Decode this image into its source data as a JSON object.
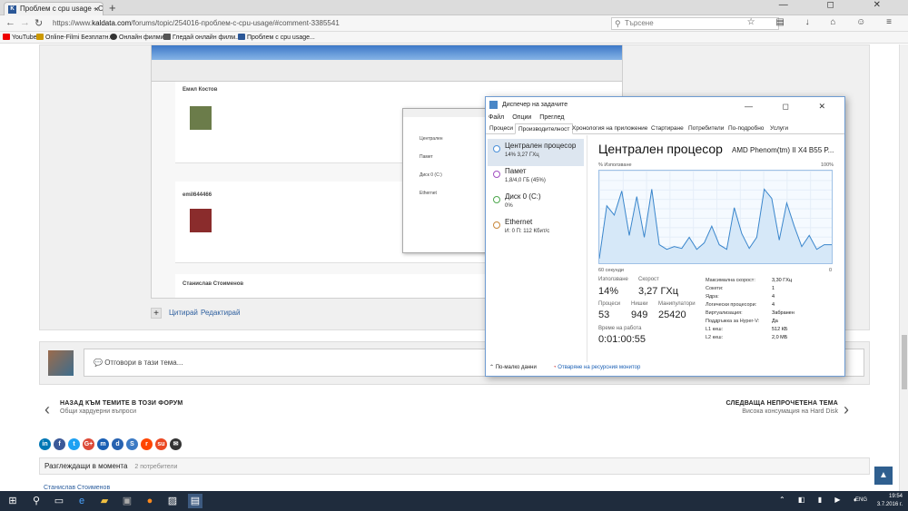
{
  "browser": {
    "tab_title": "Проблем с cpu usage - O...",
    "url_prefix": "https://www.",
    "url_domain": "kaldata.com",
    "url_rest": "/forums/topic/254016-проблем-с-cpu-usage/#comment-3385541",
    "search_placeholder": "Търсене",
    "bookmarks": [
      "YouTube",
      "Online-Filmi Безплатн...",
      "Онлайн филми",
      "Гледай онлайн филм...",
      "Проблем с cpu usage..."
    ]
  },
  "post_actions": {
    "quote": "Цитирай",
    "edit": "Редактирай"
  },
  "reply": {
    "placeholder": "Отговори в тази тема..."
  },
  "prev": {
    "title": "НАЗАД КЪМ ТЕМИТЕ В ТОЗИ ФОРУМ",
    "subtitle": "Общи хардуерни въпроси"
  },
  "next": {
    "title": "СЛЕДВАЩА НЕПРОЧЕТЕНА ТЕМА",
    "subtitle": "Висока консумация на Hard Disk"
  },
  "share_buttons": [
    "in",
    "f",
    "t",
    "G+",
    "m",
    "d",
    "S",
    "r",
    "su",
    "✉"
  ],
  "viewing": {
    "label": "Разглеждащи в момента",
    "count": "2 потребители"
  },
  "last_viewer": "Станислав Стоименов",
  "taskmanager": {
    "title": "Диспечер на задачите",
    "menu": [
      "Файл",
      "Опции",
      "Преглед"
    ],
    "tabs": [
      "Процеси",
      "Производителност",
      "Хронология на приложение",
      "Стартиране",
      "Потребители",
      "По-подробно",
      "Услуги"
    ],
    "resources": [
      {
        "name": "Централен процесор",
        "value": "14%  3,27 ГХц"
      },
      {
        "name": "Памет",
        "value": "1,8/4,0 ГБ (45%)"
      },
      {
        "name": "Диск 0 (C:)",
        "value": "0%"
      },
      {
        "name": "Ethernet",
        "value": "И: 0  П: 112 Кбит/с"
      }
    ],
    "cpu_heading": "Централен процесор",
    "cpu_model": "AMD Phenom(tm) II X4 B55 P...",
    "usage_label": "% Използване",
    "max_label": "100%",
    "time_label": "60 секунди",
    "zero_label": "0",
    "stats": {
      "usage_label": "Използване",
      "usage": "14%",
      "speed_label": "Скорост",
      "speed": "3,27 ГХц",
      "processes_label": "Процеси",
      "processes": "53",
      "threads_label": "Нишки",
      "threads": "949",
      "handles_label": "Манипулатори",
      "handles": "25420",
      "uptime_label": "Време на работа",
      "uptime": "0:01:00:55"
    },
    "specs": [
      {
        "k": "Максимална скорост:",
        "v": "3,30 ГХц"
      },
      {
        "k": "Сокети:",
        "v": "1"
      },
      {
        "k": "Ядра:",
        "v": "4"
      },
      {
        "k": "Логически процесори:",
        "v": "4"
      },
      {
        "k": "Виртуализация:",
        "v": "Забранен"
      },
      {
        "k": "Поддръжка за Hyper-V:",
        "v": "Да"
      },
      {
        "k": "L1 кеш:",
        "v": "512 КБ"
      },
      {
        "k": "L2 кеш:",
        "v": "2,0 МБ"
      }
    ],
    "cpu_history": [
      5,
      62,
      52,
      78,
      30,
      72,
      28,
      80,
      20,
      15,
      18,
      16,
      28,
      15,
      22,
      40,
      20,
      15,
      60,
      32,
      16,
      28,
      80,
      70,
      25,
      65,
      40,
      18,
      30,
      15,
      20,
      20
    ],
    "footer_less": "По-малко данни",
    "footer_monitor": "Отваряне на ресурсния монитор"
  },
  "mini_tm": {
    "res": [
      "Централен",
      "Памет",
      "Диск 0 (C:)",
      "Ethernet"
    ]
  },
  "screenshot_names": [
    "Емил Костов",
    "emil644466",
    "Станислав Стоименов"
  ],
  "clock": {
    "time": "19:54",
    "date": "3.7.2016 г."
  },
  "lang": "ENG"
}
